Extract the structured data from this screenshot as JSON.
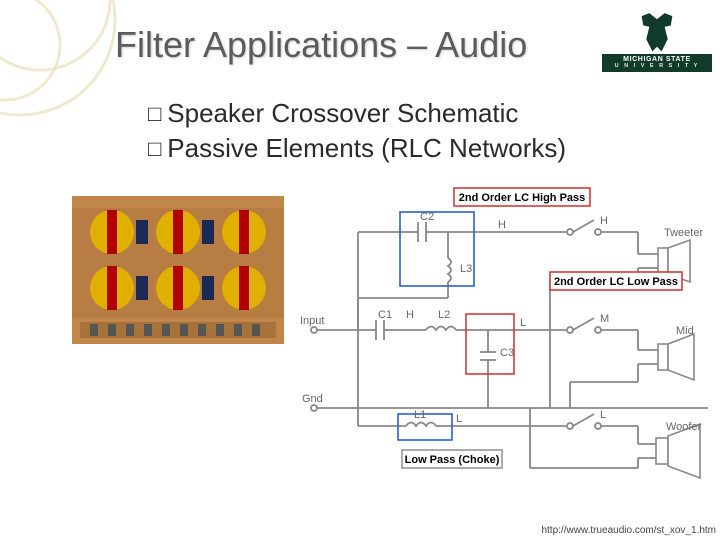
{
  "title": "Filter Applications – Audio",
  "bullets": [
    {
      "glyph": "□",
      "text": "Speaker Crossover Schematic"
    },
    {
      "glyph": "□",
      "text": "Passive Elements (RLC Networks)"
    }
  ],
  "logo": {
    "brand_top": "MICHIGAN STATE",
    "brand_bottom": "U N I V E R S I T Y"
  },
  "schematic": {
    "title_hp": "2nd Order LC High Pass",
    "title_lp": "2nd Order LC Low Pass",
    "title_choke": "Low Pass (Choke)",
    "spk_tweeter": "Tweeter",
    "spk_mid": "Mid",
    "spk_woofer": "Woofer",
    "node_input": "Input",
    "node_gnd": "Gnd",
    "comp": {
      "C1": "C1",
      "C2": "C2",
      "C3": "C3",
      "L1": "L1",
      "L2": "L2",
      "L3": "L3",
      "H1": "H",
      "H2": "H",
      "L_out1": "L",
      "L_out2": "L",
      "M": "M"
    },
    "switches": {
      "H": "H",
      "L": "L",
      "M": "M"
    }
  },
  "source_url": "http://www.trueaudio.com/st_xov_1.htm",
  "colors": {
    "hp_box": "#2a5ed4",
    "lp_box": "#d33a3a",
    "choke_box": "#2a5ed4",
    "accent_green": "#103b2b",
    "deco": "#d9c88a"
  }
}
